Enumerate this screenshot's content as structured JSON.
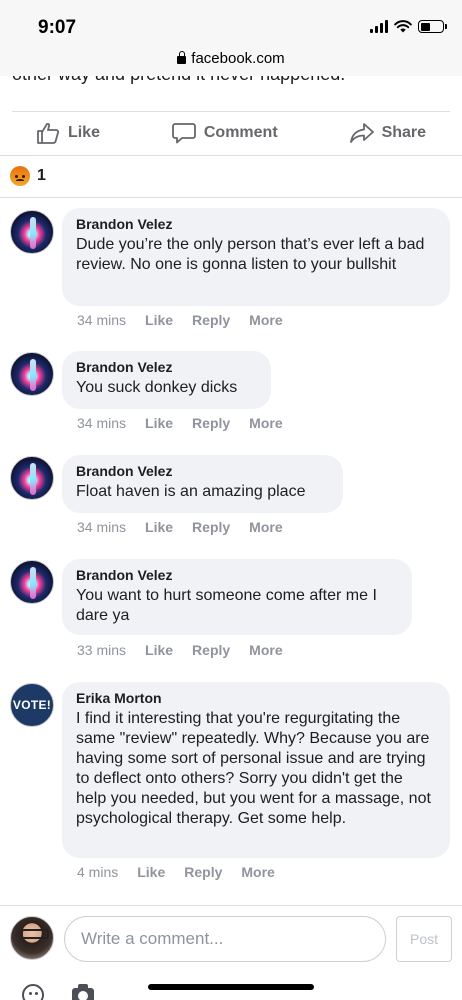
{
  "status": {
    "time": "9:07"
  },
  "browser": {
    "url": "facebook.com"
  },
  "post": {
    "clipped_text": "other way and pretend it never happened."
  },
  "actions": {
    "like": "Like",
    "comment": "Comment",
    "share": "Share"
  },
  "reactions": {
    "icon": "angry-emoji-icon",
    "count": "1"
  },
  "comments": [
    {
      "author": "Brandon Velez",
      "text": "Dude you’re the only person that’s ever left a bad review. No one is gonna listen to your bullshit",
      "time": "34 mins",
      "like": "Like",
      "reply": "Reply",
      "more": "More"
    },
    {
      "author": "Brandon Velez",
      "text": "You suck donkey dicks",
      "time": "34 mins",
      "like": "Like",
      "reply": "Reply",
      "more": "More"
    },
    {
      "author": "Brandon Velez",
      "text": "Float haven is an amazing place",
      "time": "34 mins",
      "like": "Like",
      "reply": "Reply",
      "more": "More"
    },
    {
      "author": "Brandon Velez",
      "text": "You want to hurt someone come after me I dare ya",
      "time": "33 mins",
      "like": "Like",
      "reply": "Reply",
      "more": "More"
    },
    {
      "author": "Erika Morton",
      "avatar_text": "VOTE!",
      "text": "I find it interesting that you're regurgitating the same \"review\" repeatedly. Why? Because you are having some sort of personal issue and are trying to deflect onto others? Sorry you didn't get the help you needed, but you went for a massage, not psychological therapy. Get some help.",
      "time": "4 mins",
      "like": "Like",
      "reply": "Reply",
      "more": "More"
    }
  ],
  "composer": {
    "placeholder": "Write a comment...",
    "post_label": "Post"
  },
  "colors": {
    "bubble": "#f0f2f5",
    "meta_text": "#90949c",
    "action_text": "#65676b"
  }
}
